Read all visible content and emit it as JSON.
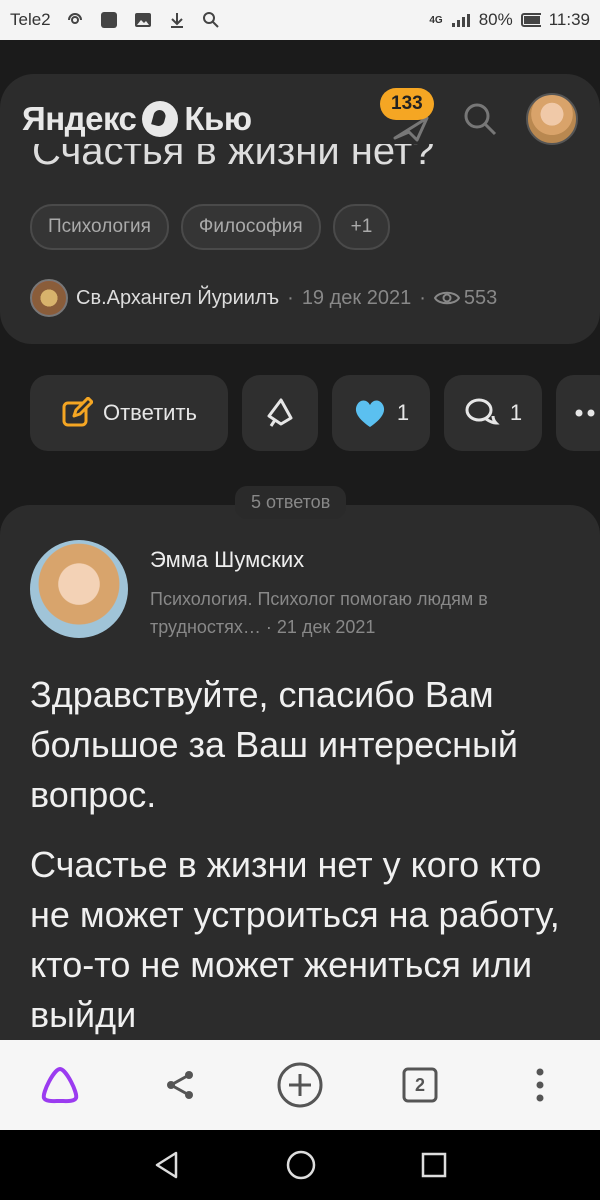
{
  "status_bar": {
    "carrier": "Tele2",
    "network": "4G",
    "battery": "80%",
    "time": "11:39"
  },
  "header": {
    "logo_text_left": "Яндекс",
    "logo_text_right": "Кью",
    "notification_count": "133"
  },
  "question": {
    "title_fragment": "Счастья в жизни нет?",
    "tags": [
      "Психология",
      "Философия",
      "+1"
    ],
    "author": "Св.Архангел Йуриилъ",
    "date": "19 дек 2021",
    "views": "553"
  },
  "actions": {
    "reply_label": "Ответить",
    "likes": "1",
    "comments": "1"
  },
  "answers_count_label": "5 ответов",
  "answer": {
    "author": "Эмма Шумских",
    "description": "Психология. Психолог помогаю людям в трудностях…",
    "date": "21 дек 2021",
    "paragraphs": [
      "Здравствуйте, спасибо Вам большое за Ваш интересный вопрос.",
      "Счастье в жизни нет у кого кто не может устроиться на работу, кто-то не может жениться или выйди"
    ]
  },
  "toolbar": {
    "tabs_count": "2"
  },
  "colors": {
    "accent_orange": "#f5a623",
    "heart_blue": "#5bc0f0",
    "alice_purple": "#9b3bf0",
    "edit_orange": "#f5a623"
  }
}
